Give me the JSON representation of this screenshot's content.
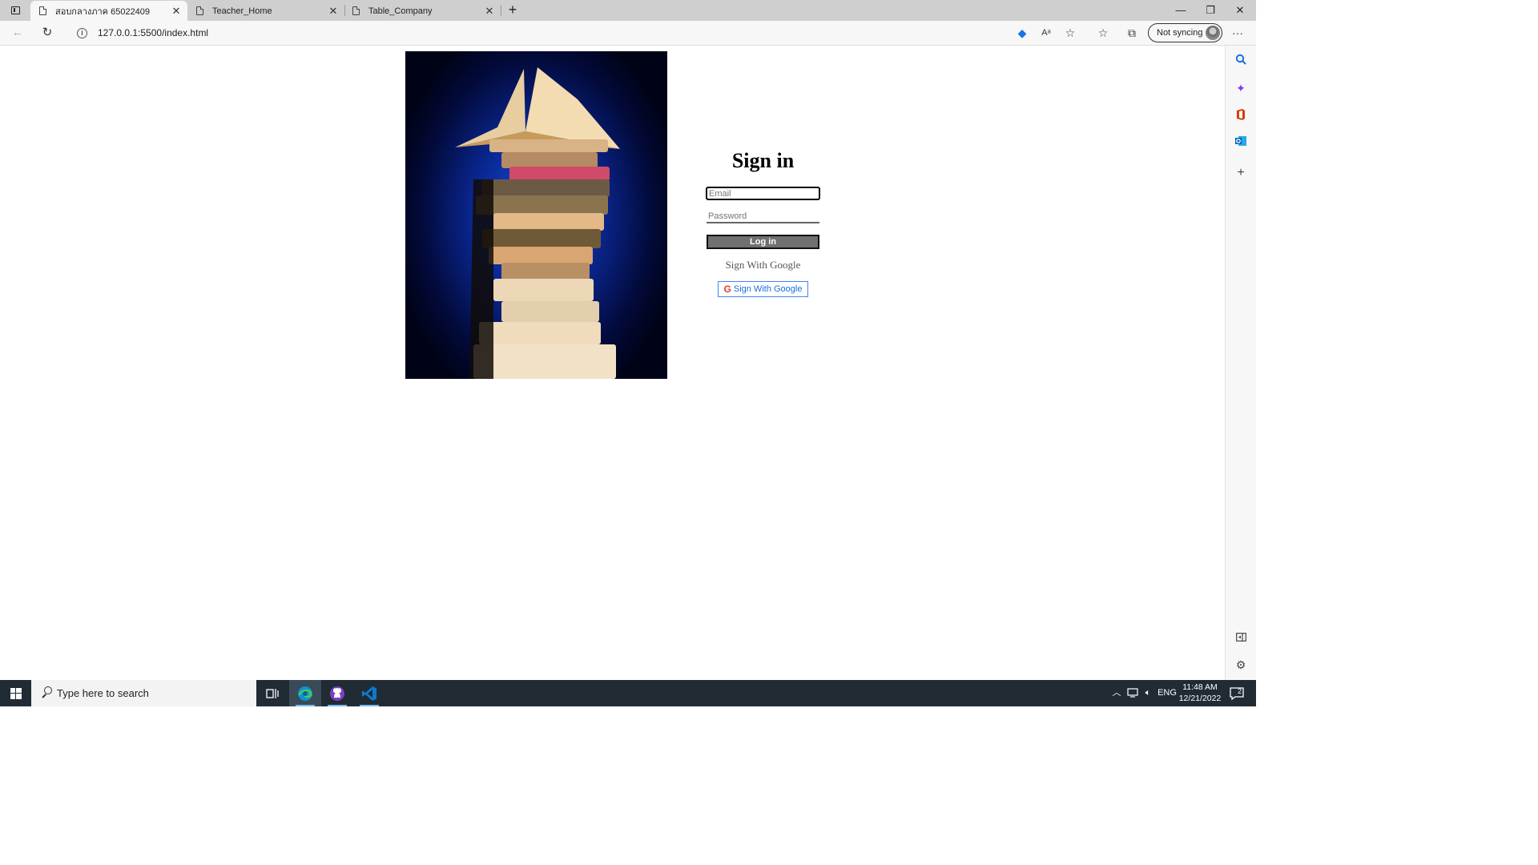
{
  "browser": {
    "tabs": [
      {
        "title": "สอบกลางภาค 65022409",
        "active": true
      },
      {
        "title": "Teacher_Home",
        "active": false
      },
      {
        "title": "Table_Company",
        "active": false
      }
    ],
    "new_tab": "+",
    "window": {
      "minimize": "—",
      "restore": "❐",
      "close": "✕"
    },
    "address": {
      "url": "127.0.0.1:5500/index.html",
      "info": "i"
    },
    "sync": {
      "label": "Not syncing"
    },
    "more": "···"
  },
  "page": {
    "title": "Sign in",
    "email_placeholder": "Email",
    "password_placeholder": "Password",
    "login_label": "Log in",
    "google_text": "Sign With Google",
    "google_button_label": "Sign With Google",
    "google_icon": "G"
  },
  "sidebar": {
    "icons": [
      "search-icon",
      "copilot-icon",
      "office-icon",
      "outlook-icon",
      "add-icon",
      "hide-sidebar-icon",
      "settings-icon"
    ]
  },
  "taskbar": {
    "search_placeholder": "Type here to search",
    "apps": [
      "task-view",
      "edge",
      "github-desktop",
      "vscode"
    ],
    "language": "ENG",
    "time": "11:48 AM",
    "date": "12/21/2022",
    "notifications": "2"
  }
}
